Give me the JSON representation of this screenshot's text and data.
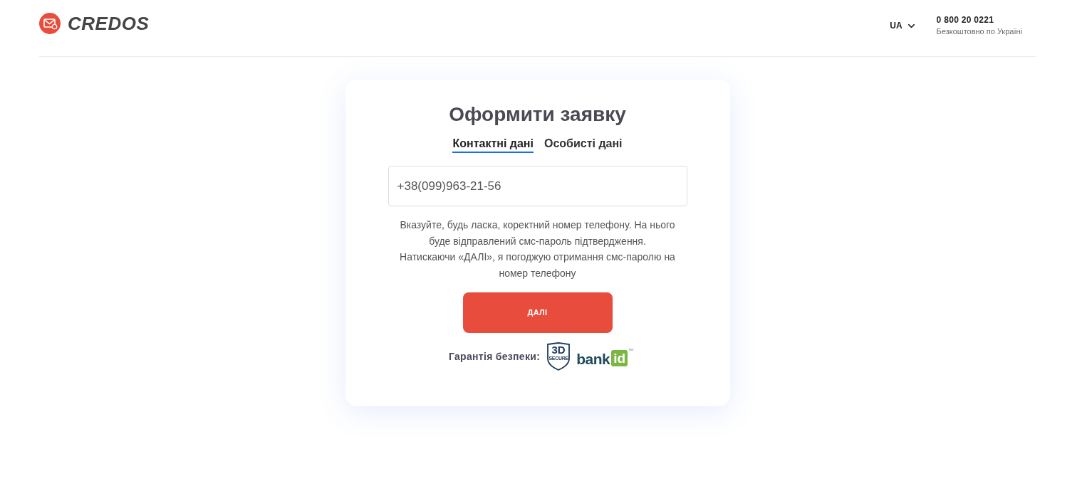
{
  "header": {
    "logo": {
      "name": "CREDOS"
    },
    "language": {
      "code": "UA"
    },
    "phone": {
      "number": "0 800 20 0221",
      "note": "Безкоштовно по Україні"
    }
  },
  "form": {
    "title": "Оформити заявку",
    "tabs": [
      {
        "label": "Контактні дані",
        "selected": true
      },
      {
        "label": "Особисті дані",
        "selected": false
      }
    ],
    "phone_field": {
      "value": "+38(099)963-21-56"
    },
    "hints": [
      "Вказуйте, будь ласка, коректний номер телефону. На нього буде відправлений смс-пароль підтвердження.",
      "Натискаючи «ДАЛІ», я погоджую отримання смс-паролю на номер телефону"
    ],
    "submit": "ДАЛІ",
    "security": {
      "label": "Гарантія безпеки:",
      "badges": [
        {
          "kind": "shield",
          "text": "3D",
          "subtext": "SECURE"
        },
        {
          "kind": "tile",
          "text": "bank",
          "subtext": "id",
          "mark": "™"
        }
      ]
    }
  }
}
